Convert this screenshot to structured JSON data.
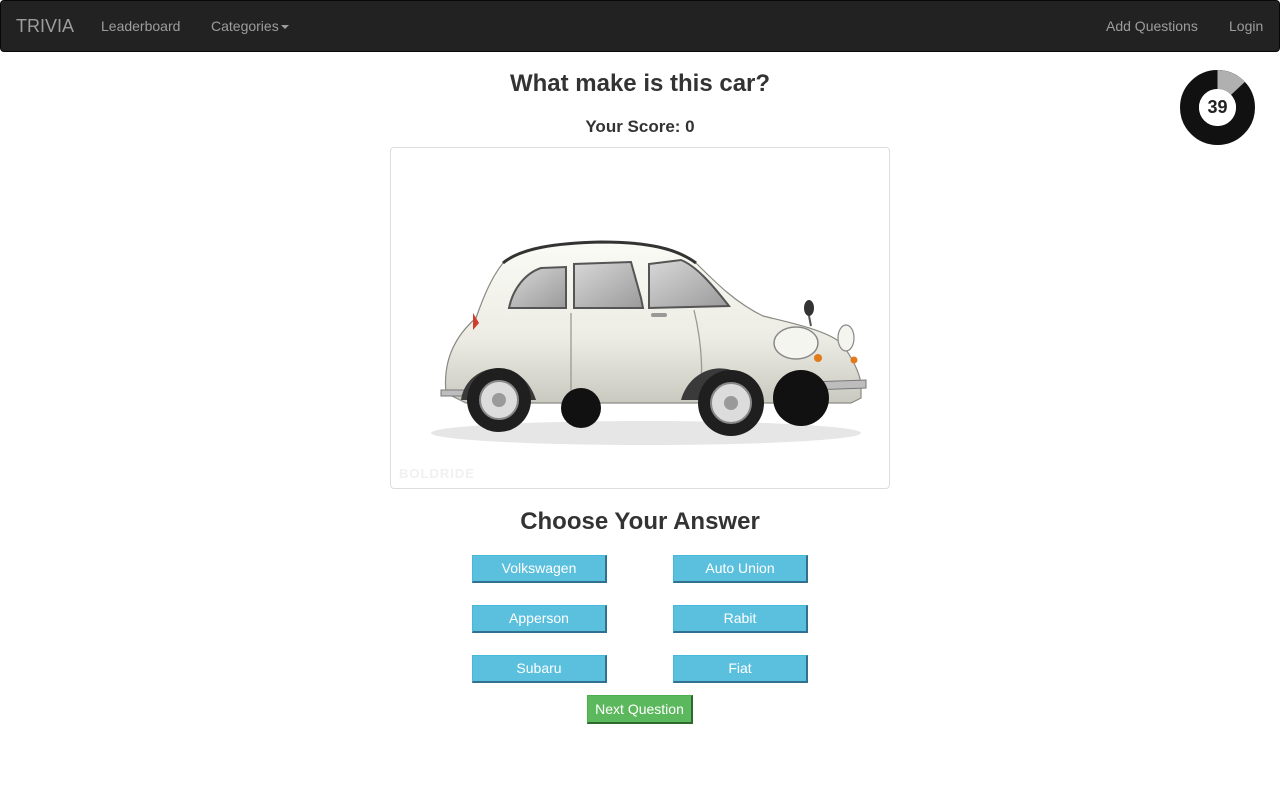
{
  "navbar": {
    "brand": "TRIVIA",
    "left_items": [
      {
        "label": "Leaderboard"
      },
      {
        "label": "Categories"
      }
    ],
    "right_items": [
      {
        "label": "Add Questions"
      },
      {
        "label": "Login"
      }
    ]
  },
  "quiz": {
    "question": "What make is this car?",
    "score_label": "Your Score: 0",
    "timer": {
      "value": "39",
      "remaining_fraction": 0.87
    },
    "image": {
      "watermark": "BOLDRIDE",
      "icon": "white-classic-car"
    },
    "choose_heading": "Choose Your Answer",
    "answers": [
      {
        "label": "Volkswagen"
      },
      {
        "label": "Auto Union"
      },
      {
        "label": "Apperson"
      },
      {
        "label": "Rabit"
      },
      {
        "label": "Subaru"
      },
      {
        "label": "Fiat"
      }
    ],
    "next_button": "Next Question"
  },
  "colors": {
    "navbar_bg": "#222222",
    "answer_button": "#5bc0de",
    "next_button": "#5cb85c",
    "timer_ring": "#111111",
    "timer_elapsed": "#b0b0b0"
  }
}
